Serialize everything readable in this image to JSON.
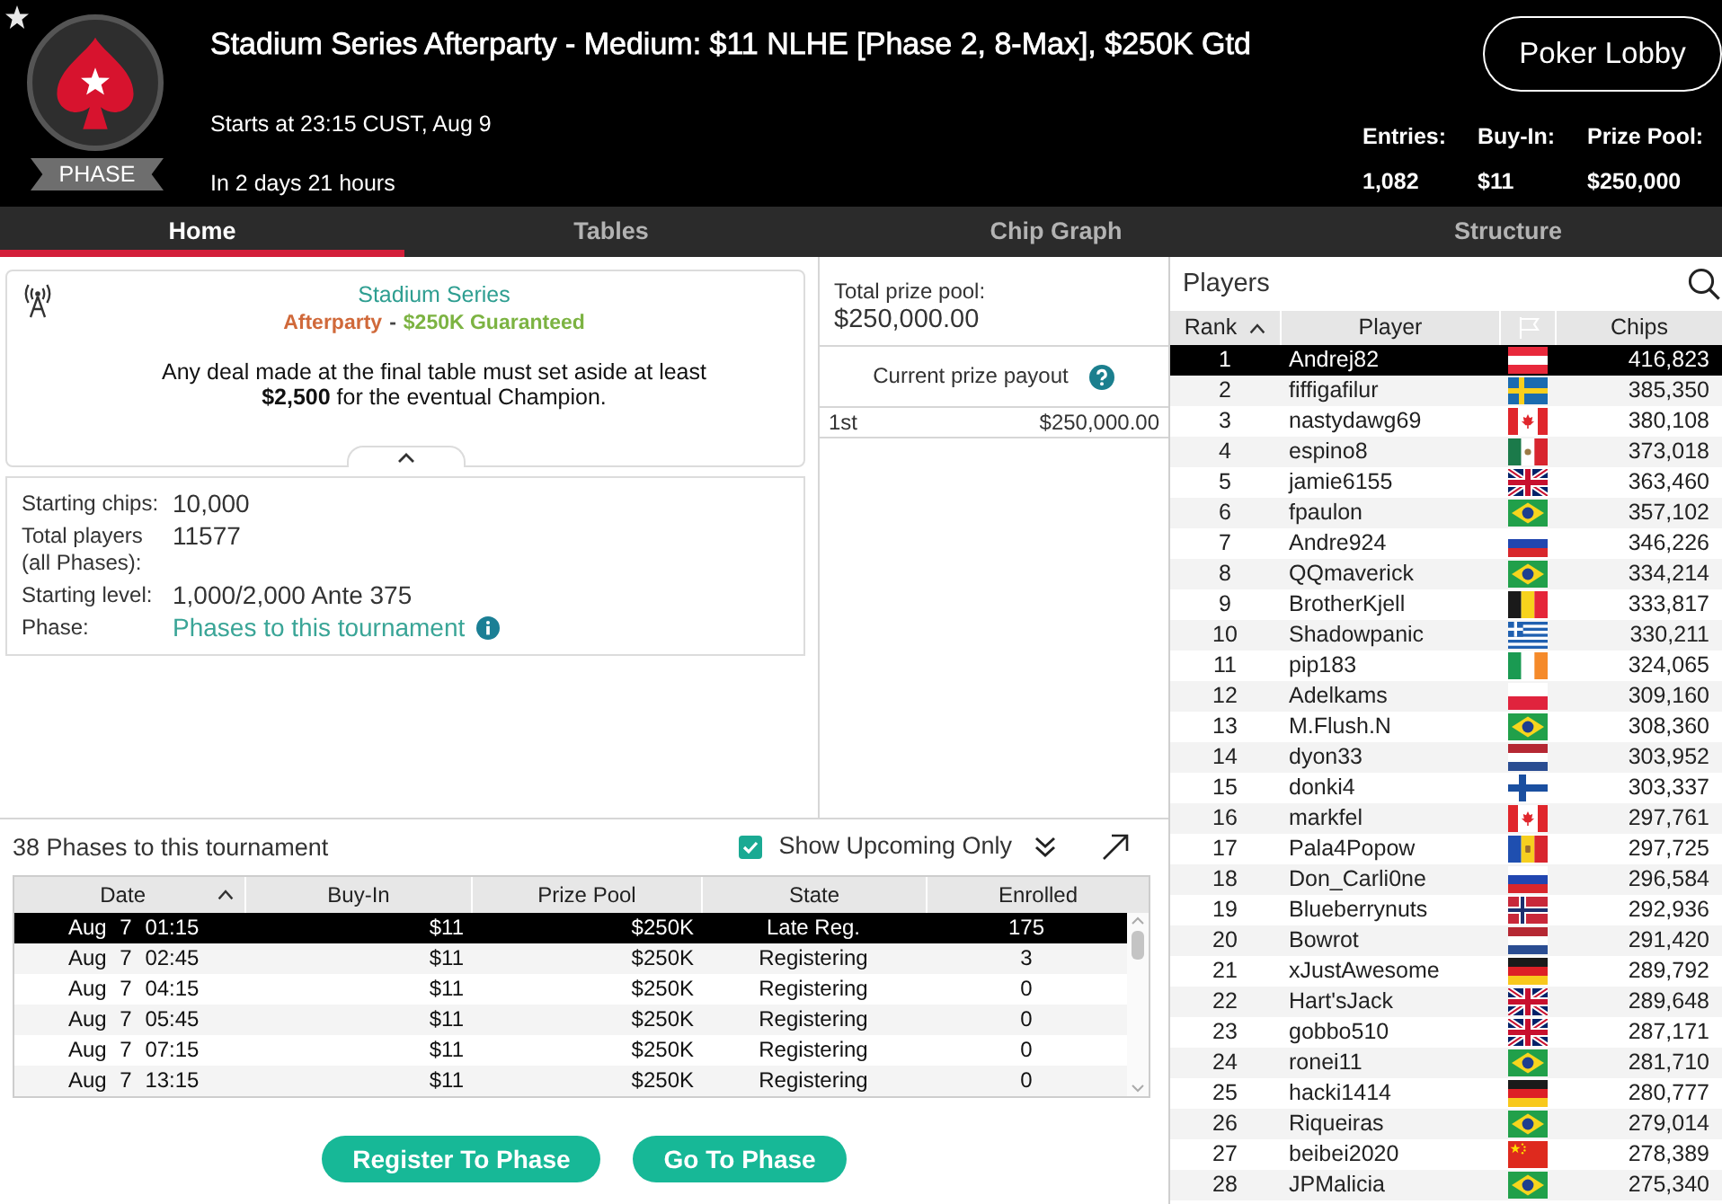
{
  "header": {
    "badge": "PHASE",
    "title": "Stadium Series Afterparty - Medium: $11 NLHE [Phase 2, 8-Max], $250K Gtd",
    "start_time": "Starts at 23:15 CUST, Aug 9",
    "countdown": "In 2 days 21 hours",
    "lobby_button": "Poker Lobby",
    "stats": [
      {
        "label": "Entries:",
        "value": "1,082"
      },
      {
        "label": "Buy-In:",
        "value": "$11"
      },
      {
        "label": "Prize Pool:",
        "value": "$250,000"
      }
    ]
  },
  "tabs": [
    {
      "label": "Home",
      "selected": true
    },
    {
      "label": "Tables",
      "selected": false
    },
    {
      "label": "Chip Graph",
      "selected": false
    },
    {
      "label": "Structure",
      "selected": false
    }
  ],
  "notice": {
    "title": "Stadium Series",
    "subtitle": [
      {
        "text": "Afterparty",
        "color": "#d0693a"
      },
      {
        "text": "-",
        "color": "#444444"
      },
      {
        "text": "$250K Guaranteed",
        "color": "#7cb342"
      }
    ],
    "message": "Any deal made at the final table must set aside at least **$2,500** for the eventual Champion."
  },
  "details": [
    {
      "kind": "text",
      "label": "Starting chips:",
      "value": "10,000"
    },
    {
      "kind": "text",
      "label": "Total players (all Phases):",
      "value": "11577"
    },
    {
      "kind": "text",
      "label": "Starting level:",
      "value": "1,000/2,000 Ante 375"
    },
    {
      "kind": "link",
      "label": "Phase:",
      "value": "Phases to this tournament"
    }
  ],
  "prize": {
    "total_label": "Total prize pool:",
    "total": "$250,000.00",
    "payout_title": "Current prize payout",
    "payouts": [
      {
        "place": "1st",
        "amount": "$250,000.00"
      }
    ]
  },
  "phases": {
    "title": "38 Phases to this tournament",
    "show_upcoming": {
      "label": "Show Upcoming Only",
      "checked": true
    },
    "columns": [
      {
        "label": "Date",
        "sorted": true
      },
      {
        "label": "Buy-In",
        "sorted": false
      },
      {
        "label": "Prize Pool",
        "sorted": false
      },
      {
        "label": "State",
        "sorted": false
      },
      {
        "label": "Enrolled",
        "sorted": false
      }
    ],
    "rows": [
      {
        "date": "Aug 7 01:15",
        "buy_in": "$11",
        "prize_pool": "$250K",
        "state": "Late Reg.",
        "enrolled": "175",
        "selected": true
      },
      {
        "date": "Aug 7 02:45",
        "buy_in": "$11",
        "prize_pool": "$250K",
        "state": "Registering",
        "enrolled": "3",
        "selected": false
      },
      {
        "date": "Aug 7 04:15",
        "buy_in": "$11",
        "prize_pool": "$250K",
        "state": "Registering",
        "enrolled": "0",
        "selected": false
      },
      {
        "date": "Aug 7 05:45",
        "buy_in": "$11",
        "prize_pool": "$250K",
        "state": "Registering",
        "enrolled": "0",
        "selected": false
      },
      {
        "date": "Aug 7 07:15",
        "buy_in": "$11",
        "prize_pool": "$250K",
        "state": "Registering",
        "enrolled": "0",
        "selected": false
      },
      {
        "date": "Aug 7 13:15",
        "buy_in": "$11",
        "prize_pool": "$250K",
        "state": "Registering",
        "enrolled": "0",
        "selected": false
      }
    ]
  },
  "buttons": [
    "Register To Phase",
    "Go To Phase"
  ],
  "players": {
    "title": "Players",
    "columns": [
      {
        "kind": "text",
        "label": "Rank",
        "sorted": true
      },
      {
        "kind": "text",
        "label": "Player",
        "sorted": false
      },
      {
        "kind": "flag"
      },
      {
        "kind": "text",
        "label": "Chips",
        "sorted": false
      }
    ],
    "rows": [
      {
        "rank": "1",
        "name": "Andrej82",
        "kind": "austria",
        "chips": "416,823",
        "selected": true
      },
      {
        "rank": "2",
        "name": "fiffigafilur",
        "kind": "sweden",
        "chips": "385,350",
        "selected": false
      },
      {
        "rank": "3",
        "name": "nastydawg69",
        "kind": "canada",
        "chips": "380,108",
        "selected": false
      },
      {
        "rank": "4",
        "name": "espino8",
        "kind": "mexico",
        "chips": "373,018",
        "selected": false
      },
      {
        "rank": "5",
        "name": "jamie6155",
        "kind": "uk",
        "chips": "363,460",
        "selected": false
      },
      {
        "rank": "6",
        "name": "fpaulon",
        "kind": "brazil",
        "chips": "357,102",
        "selected": false
      },
      {
        "rank": "7",
        "name": "Andre924",
        "kind": "russia",
        "chips": "346,226",
        "selected": false
      },
      {
        "rank": "8",
        "name": "QQmaverick",
        "kind": "brazil",
        "chips": "334,214",
        "selected": false
      },
      {
        "rank": "9",
        "name": "BrotherKjell",
        "kind": "belgium",
        "chips": "333,817",
        "selected": false
      },
      {
        "rank": "10",
        "name": "Shadowpanic",
        "kind": "greece",
        "chips": "330,211",
        "selected": false
      },
      {
        "rank": "11",
        "name": "pip183",
        "kind": "ireland",
        "chips": "324,065",
        "selected": false
      },
      {
        "rank": "12",
        "name": "Adelkams",
        "kind": "poland",
        "chips": "309,160",
        "selected": false
      },
      {
        "rank": "13",
        "name": "M.Flush.N",
        "kind": "brazil",
        "chips": "308,360",
        "selected": false
      },
      {
        "rank": "14",
        "name": "dyon33",
        "kind": "netherlands",
        "chips": "303,952",
        "selected": false
      },
      {
        "rank": "15",
        "name": "donki4",
        "kind": "finland",
        "chips": "303,337",
        "selected": false
      },
      {
        "rank": "16",
        "name": "markfel",
        "kind": "canada",
        "chips": "297,761",
        "selected": false
      },
      {
        "rank": "17",
        "name": "Pala4Popow",
        "kind": "moldova",
        "chips": "297,725",
        "selected": false
      },
      {
        "rank": "18",
        "name": "Don_Carli0ne",
        "kind": "russia",
        "chips": "296,584",
        "selected": false
      },
      {
        "rank": "19",
        "name": "Blueberrynuts",
        "kind": "norway",
        "chips": "292,936",
        "selected": false
      },
      {
        "rank": "20",
        "name": "Bowrot",
        "kind": "netherlands",
        "chips": "291,420",
        "selected": false
      },
      {
        "rank": "21",
        "name": "xJustAwesome",
        "kind": "germany",
        "chips": "289,792",
        "selected": false
      },
      {
        "rank": "22",
        "name": "Hart'sJack",
        "kind": "uk",
        "chips": "289,648",
        "selected": false
      },
      {
        "rank": "23",
        "name": "gobbo510",
        "kind": "uk",
        "chips": "287,171",
        "selected": false
      },
      {
        "rank": "24",
        "name": "ronei11",
        "kind": "brazil",
        "chips": "281,710",
        "selected": false
      },
      {
        "rank": "25",
        "name": "hacki1414",
        "kind": "germany",
        "chips": "280,777",
        "selected": false
      },
      {
        "rank": "26",
        "name": "Riqueiras",
        "kind": "brazil",
        "chips": "279,014",
        "selected": false
      },
      {
        "rank": "27",
        "name": "beibei2020",
        "kind": "china",
        "chips": "278,389",
        "selected": false
      },
      {
        "rank": "28",
        "name": "JPMalicia",
        "kind": "brazil",
        "chips": "275,340",
        "selected": false
      }
    ]
  }
}
